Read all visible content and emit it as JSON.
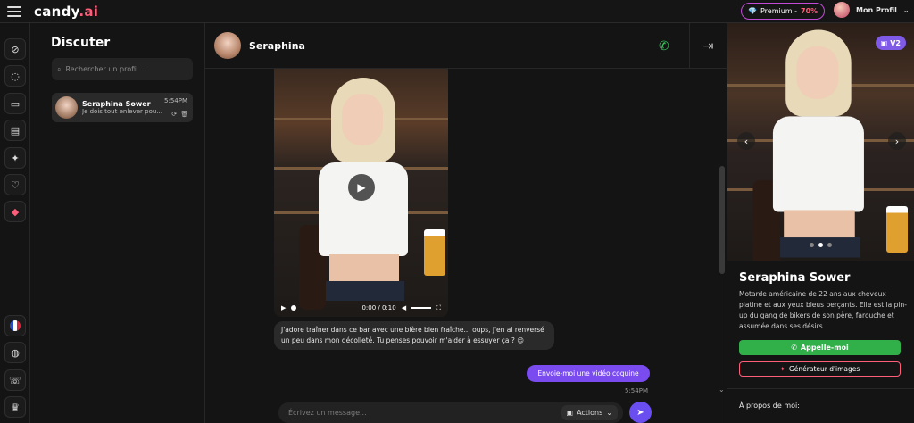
{
  "topbar": {
    "logo_main": "candy",
    "logo_dot": ".ai",
    "premium_label": "Premium -",
    "premium_pct": "70%",
    "profile_label": "Mon Profil"
  },
  "rail": {
    "icons": [
      "compass-icon",
      "chat-icon",
      "gallery-icon",
      "cards-icon",
      "magic-wand-icon",
      "heart-icon",
      "gem-icon",
      "flag-icon",
      "discord-icon",
      "chat-support-icon",
      "trophy-icon"
    ]
  },
  "chat_list": {
    "title": "Discuter",
    "search_placeholder": "Rechercher un profil...",
    "conversations": [
      {
        "name": "Seraphina Sower",
        "preview": "Je dois tout enlever pou...",
        "time": "5:54PM"
      }
    ]
  },
  "chat": {
    "name": "Seraphina",
    "video_time": "0:00 / 0:10",
    "message": "J'adore traîner dans ce bar avec une bière bien fraîche... oups, j'en ai renversé un peu dans mon décolleté. Tu penses pouvoir m'aider à essuyer ça ? 😉",
    "sent": "Envoie-moi une vidéo coquine",
    "sent_time": "5:54PM",
    "composer_placeholder": "Écrivez un message...",
    "actions_label": "Actions"
  },
  "profile_panel": {
    "badge": "V2",
    "name": "Seraphina Sower",
    "description": "Motarde américaine de 22 ans aux cheveux platine et aux yeux bleus perçants. Elle est la pin-up du gang de bikers de son père, farouche et assumée dans ses désirs.",
    "call_button": "Appelle-moi",
    "gen_button": "Générateur d'images",
    "about": "À propos de moi:"
  },
  "colors": {
    "accent_purple": "#7a4cf0",
    "accent_pink": "#ff5e7a",
    "call_green": "#31b04a"
  }
}
